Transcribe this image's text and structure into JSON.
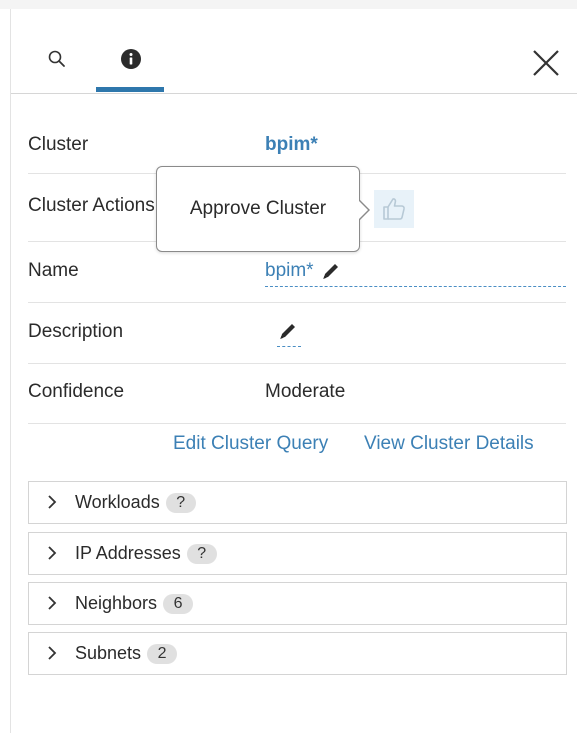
{
  "tabs": {
    "search_icon": "search-icon",
    "info_icon": "info-icon",
    "close_icon": "close-icon"
  },
  "details": {
    "cluster_label": "Cluster",
    "cluster_value": "bpim*",
    "action_label": "Cluster Actions",
    "name_label": "Name",
    "name_value": "bpim*",
    "description_label": "Description",
    "confidence_label": "Confidence",
    "confidence_value": "Moderate"
  },
  "tooltip": {
    "text": "Approve Cluster"
  },
  "links": {
    "edit_query": "Edit Cluster Query",
    "view_details": "View Cluster Details"
  },
  "sections": [
    {
      "label": "Workloads",
      "badge": "?"
    },
    {
      "label": "IP Addresses",
      "badge": "?"
    },
    {
      "label": "Neighbors",
      "badge": "6"
    },
    {
      "label": "Subnets",
      "badge": "2"
    }
  ],
  "colors": {
    "accent": "#2e77ac",
    "link": "#3c80b5",
    "thumb_bg": "#e8f2f9"
  }
}
